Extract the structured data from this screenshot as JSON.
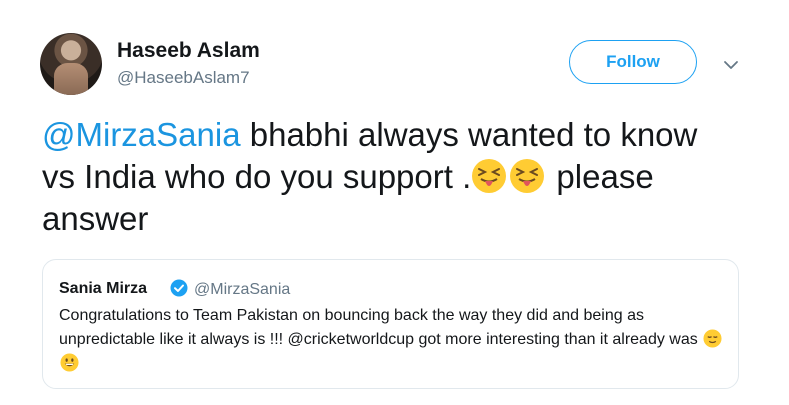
{
  "author": {
    "name": "Haseeb Aslam",
    "handle": "@HaseebAslam7"
  },
  "follow_label": "Follow",
  "tweet": {
    "mention": "@MirzaSania",
    "text_line1_rest": " bhabhi always wanted to know",
    "text_line2": "vs India who do you support .",
    "text_after_emoji": " please",
    "text_line3": "answer",
    "emojis": [
      "squinting-tongue-emoji",
      "squinting-tongue-emoji"
    ]
  },
  "quoted": {
    "name": "Sania Mirza",
    "handle": "@MirzaSania",
    "verified": true,
    "text": "Congratulations to Team Pakistan on bouncing back the way they did and being as unpredictable like it always is !!! @cricketworldcup got more interesting than it already was",
    "emojis": [
      "relieved-face-emoji",
      "grinning-face-emoji"
    ]
  },
  "colors": {
    "accent": "#1da1f2",
    "mention": "#1b95e0",
    "secondary_text": "#657786",
    "border": "#e1e8ed"
  }
}
